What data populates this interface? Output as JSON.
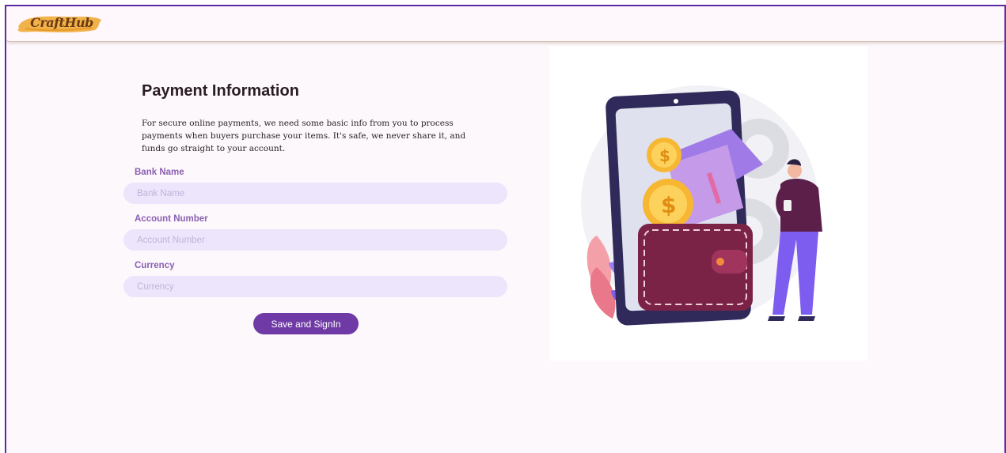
{
  "header": {
    "logo_text": "CraftHub"
  },
  "form": {
    "title": "Payment Information",
    "description": "For secure online payments, we need some basic info from you to process payments when buyers purchase your items. It's safe, we never share it, and funds go straight to your account.",
    "fields": [
      {
        "label": "Bank Name",
        "placeholder": "Bank Name",
        "value": ""
      },
      {
        "label": "Account Number",
        "placeholder": "Account Number",
        "value": ""
      },
      {
        "label": "Currency",
        "placeholder": "Currency",
        "value": ""
      }
    ],
    "submit_label": "Save and SignIn"
  },
  "illustration": {
    "icon": "payment-wallet-illustration",
    "coin_symbol": "$"
  },
  "colors": {
    "accent": "#6f3aa5",
    "label": "#8a5fb2",
    "input_bg": "#ece5fb",
    "page_bg": "#fdf8fc",
    "frame_border": "#5a2aa8"
  }
}
